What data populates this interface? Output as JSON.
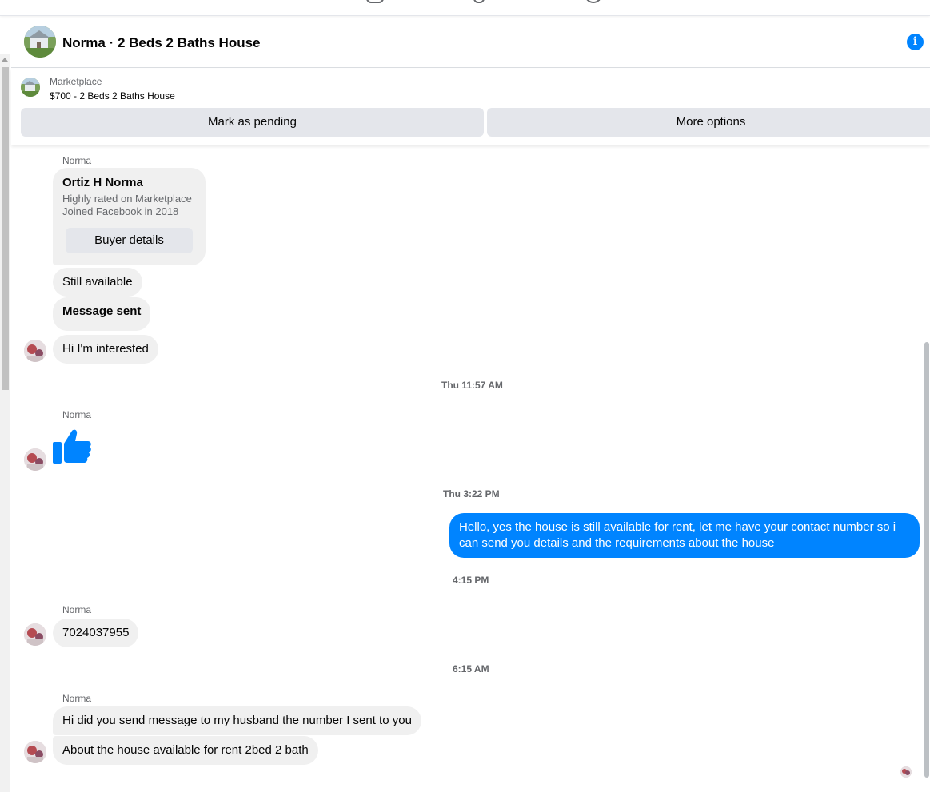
{
  "header": {
    "title": "Norma · 2 Beds 2 Baths House"
  },
  "listing": {
    "source": "Marketplace",
    "title": "$700 - 2 Beds 2 Baths House",
    "mark_pending_label": "Mark as pending",
    "more_options_label": "More options"
  },
  "buyer_card": {
    "sender": "Norma",
    "name": "Ortiz H Norma",
    "line1": "Highly rated on Marketplace",
    "line2": "Joined Facebook in 2018",
    "button_label": "Buyer details"
  },
  "messages": {
    "still_available": "Still available",
    "message_sent": "Message sent",
    "interested": "Hi I'm interested",
    "ts1": "Thu 11:57 AM",
    "sender2": "Norma",
    "ts2": "Thu 3:22 PM",
    "outgoing": "Hello, yes the house is still available for rent, let me have your contact number so i can send you details and the requirements about the house",
    "ts3": "4:15 PM",
    "sender3": "Norma",
    "phone": "7024037955",
    "ts4": "6:15 AM",
    "sender4": "Norma",
    "msg_husband": "Hi did you send message to my husband the number I sent to you",
    "msg_house": "About the house available for rent 2bed 2 bath"
  },
  "icons": {
    "info": "info-icon",
    "like": "thumbs-up-icon",
    "accent": "#0084ff"
  }
}
